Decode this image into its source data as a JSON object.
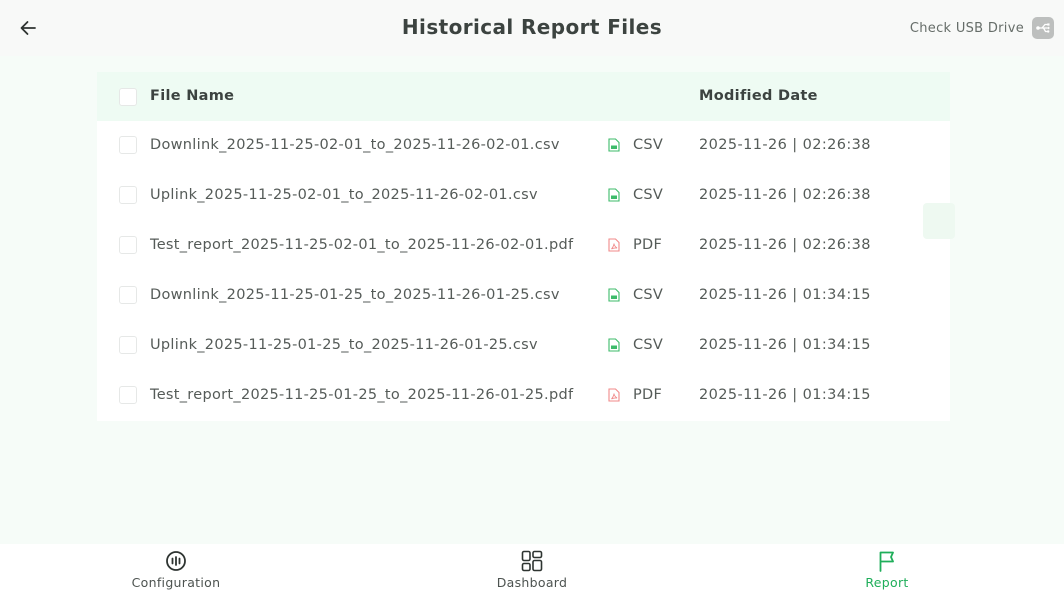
{
  "header": {
    "title": "Historical Report Files",
    "usb_label": "Check USB Drive"
  },
  "table": {
    "columns": {
      "name": "File Name",
      "date": "Modified Date"
    },
    "rows": [
      {
        "name": "Downlink_2025-11-25-02-01_to_2025-11-26-02-01.csv",
        "type": "CSV",
        "icon": "csv-file-icon",
        "date": "2025-11-26 | 02:26:38"
      },
      {
        "name": "Uplink_2025-11-25-02-01_to_2025-11-26-02-01.csv",
        "type": "CSV",
        "icon": "csv-file-icon",
        "date": "2025-11-26 | 02:26:38"
      },
      {
        "name": "Test_report_2025-11-25-02-01_to_2025-11-26-02-01.pdf",
        "type": "PDF",
        "icon": "pdf-file-icon",
        "date": "2025-11-26 | 02:26:38"
      },
      {
        "name": "Downlink_2025-11-25-01-25_to_2025-11-26-01-25.csv",
        "type": "CSV",
        "icon": "csv-file-icon",
        "date": "2025-11-26 | 01:34:15"
      },
      {
        "name": "Uplink_2025-11-25-01-25_to_2025-11-26-01-25.csv",
        "type": "CSV",
        "icon": "csv-file-icon",
        "date": "2025-11-26 | 01:34:15"
      },
      {
        "name": "Test_report_2025-11-25-01-25_to_2025-11-26-01-25.pdf",
        "type": "PDF",
        "icon": "pdf-file-icon",
        "date": "2025-11-26 | 01:34:15"
      }
    ]
  },
  "nav": {
    "items": [
      {
        "label": "Configuration",
        "icon": "gauge-icon",
        "active": false
      },
      {
        "label": "Dashboard",
        "icon": "dashboard-grid-icon",
        "active": false
      },
      {
        "label": "Report",
        "icon": "flag-icon",
        "active": true
      }
    ]
  },
  "colors": {
    "accent": "#1fae5a",
    "csv_icon": "#3dbb6a",
    "pdf_icon": "#f08a8a",
    "header_row_bg": "#eefbf3",
    "page_bg": "#f6fcf8"
  }
}
